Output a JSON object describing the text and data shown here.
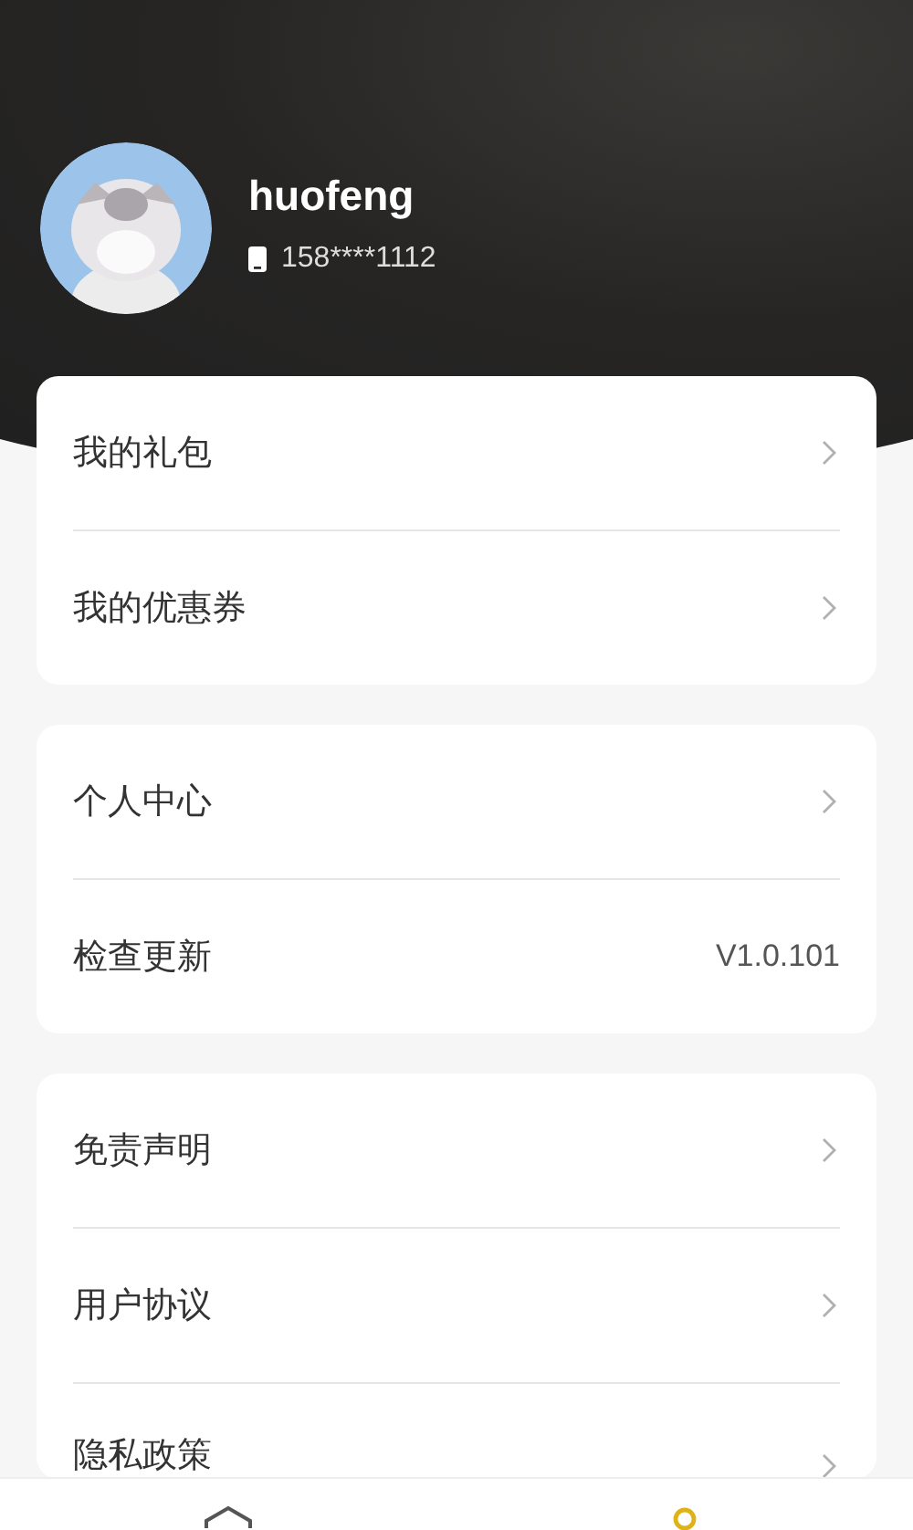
{
  "profile": {
    "name": "huofeng",
    "phone": "158****1112"
  },
  "groups": [
    {
      "items": [
        {
          "kind": "link",
          "label": "我的礼包"
        },
        {
          "kind": "link",
          "label": "我的优惠券"
        }
      ]
    },
    {
      "items": [
        {
          "kind": "link",
          "label": "个人中心"
        },
        {
          "kind": "version",
          "label": "检查更新",
          "value": "V1.0.101"
        }
      ]
    },
    {
      "items": [
        {
          "kind": "link",
          "label": "免责声明"
        },
        {
          "kind": "link",
          "label": "用户协议"
        },
        {
          "kind": "link",
          "label": "隐私政策"
        }
      ]
    }
  ],
  "tabs": [
    {
      "kind": "home",
      "selected": false
    },
    {
      "kind": "profile",
      "selected": true
    }
  ]
}
